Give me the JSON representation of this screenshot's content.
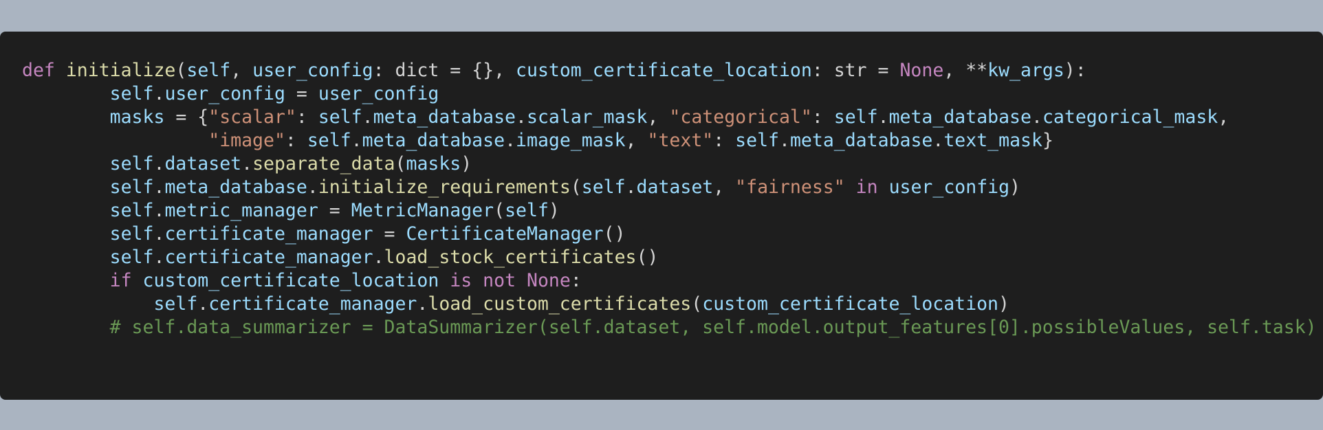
{
  "code": {
    "lines": [
      [
        {
          "t": "def",
          "c": "kw"
        },
        {
          "t": " ",
          "c": "plain"
        },
        {
          "t": "initialize",
          "c": "fn"
        },
        {
          "t": "(",
          "c": "plain"
        },
        {
          "t": "self",
          "c": "var"
        },
        {
          "t": ", ",
          "c": "plain"
        },
        {
          "t": "user_config",
          "c": "var"
        },
        {
          "t": ": dict = {}, ",
          "c": "plain"
        },
        {
          "t": "custom_certificate_location",
          "c": "var"
        },
        {
          "t": ": str = ",
          "c": "plain"
        },
        {
          "t": "None",
          "c": "kw"
        },
        {
          "t": ", **",
          "c": "plain"
        },
        {
          "t": "kw_args",
          "c": "var"
        },
        {
          "t": "):",
          "c": "plain"
        }
      ],
      [
        {
          "t": "        ",
          "c": "plain"
        },
        {
          "t": "self",
          "c": "var"
        },
        {
          "t": ".",
          "c": "plain"
        },
        {
          "t": "user_config",
          "c": "var"
        },
        {
          "t": " = ",
          "c": "plain"
        },
        {
          "t": "user_config",
          "c": "var"
        }
      ],
      [
        {
          "t": "        ",
          "c": "plain"
        },
        {
          "t": "masks",
          "c": "var"
        },
        {
          "t": " = {",
          "c": "plain"
        },
        {
          "t": "\"scalar\"",
          "c": "str"
        },
        {
          "t": ": ",
          "c": "plain"
        },
        {
          "t": "self",
          "c": "var"
        },
        {
          "t": ".",
          "c": "plain"
        },
        {
          "t": "meta_database",
          "c": "var"
        },
        {
          "t": ".",
          "c": "plain"
        },
        {
          "t": "scalar_mask",
          "c": "var"
        },
        {
          "t": ", ",
          "c": "plain"
        },
        {
          "t": "\"categorical\"",
          "c": "str"
        },
        {
          "t": ": ",
          "c": "plain"
        },
        {
          "t": "self",
          "c": "var"
        },
        {
          "t": ".",
          "c": "plain"
        },
        {
          "t": "meta_database",
          "c": "var"
        },
        {
          "t": ".",
          "c": "plain"
        },
        {
          "t": "categorical_mask",
          "c": "var"
        },
        {
          "t": ",",
          "c": "plain"
        }
      ],
      [
        {
          "t": "                 ",
          "c": "plain"
        },
        {
          "t": "\"image\"",
          "c": "str"
        },
        {
          "t": ": ",
          "c": "plain"
        },
        {
          "t": "self",
          "c": "var"
        },
        {
          "t": ".",
          "c": "plain"
        },
        {
          "t": "meta_database",
          "c": "var"
        },
        {
          "t": ".",
          "c": "plain"
        },
        {
          "t": "image_mask",
          "c": "var"
        },
        {
          "t": ", ",
          "c": "plain"
        },
        {
          "t": "\"text\"",
          "c": "str"
        },
        {
          "t": ": ",
          "c": "plain"
        },
        {
          "t": "self",
          "c": "var"
        },
        {
          "t": ".",
          "c": "plain"
        },
        {
          "t": "meta_database",
          "c": "var"
        },
        {
          "t": ".",
          "c": "plain"
        },
        {
          "t": "text_mask",
          "c": "var"
        },
        {
          "t": "}",
          "c": "plain"
        }
      ],
      [
        {
          "t": "        ",
          "c": "plain"
        },
        {
          "t": "self",
          "c": "var"
        },
        {
          "t": ".",
          "c": "plain"
        },
        {
          "t": "dataset",
          "c": "var"
        },
        {
          "t": ".",
          "c": "plain"
        },
        {
          "t": "separate_data",
          "c": "fn"
        },
        {
          "t": "(",
          "c": "plain"
        },
        {
          "t": "masks",
          "c": "var"
        },
        {
          "t": ")",
          "c": "plain"
        }
      ],
      [
        {
          "t": "        ",
          "c": "plain"
        },
        {
          "t": "self",
          "c": "var"
        },
        {
          "t": ".",
          "c": "plain"
        },
        {
          "t": "meta_database",
          "c": "var"
        },
        {
          "t": ".",
          "c": "plain"
        },
        {
          "t": "initialize_requirements",
          "c": "fn"
        },
        {
          "t": "(",
          "c": "plain"
        },
        {
          "t": "self",
          "c": "var"
        },
        {
          "t": ".",
          "c": "plain"
        },
        {
          "t": "dataset",
          "c": "var"
        },
        {
          "t": ", ",
          "c": "plain"
        },
        {
          "t": "\"fairness\"",
          "c": "str"
        },
        {
          "t": " ",
          "c": "plain"
        },
        {
          "t": "in",
          "c": "kw"
        },
        {
          "t": " ",
          "c": "plain"
        },
        {
          "t": "user_config",
          "c": "var"
        },
        {
          "t": ")",
          "c": "plain"
        }
      ],
      [
        {
          "t": "        ",
          "c": "plain"
        },
        {
          "t": "self",
          "c": "var"
        },
        {
          "t": ".",
          "c": "plain"
        },
        {
          "t": "metric_manager",
          "c": "var"
        },
        {
          "t": " = ",
          "c": "plain"
        },
        {
          "t": "MetricManager",
          "c": "cls2"
        },
        {
          "t": "(",
          "c": "plain"
        },
        {
          "t": "self",
          "c": "var"
        },
        {
          "t": ")",
          "c": "plain"
        }
      ],
      [
        {
          "t": "        ",
          "c": "plain"
        },
        {
          "t": "self",
          "c": "var"
        },
        {
          "t": ".",
          "c": "plain"
        },
        {
          "t": "certificate_manager",
          "c": "var"
        },
        {
          "t": " = ",
          "c": "plain"
        },
        {
          "t": "CertificateManager",
          "c": "cls2"
        },
        {
          "t": "()",
          "c": "plain"
        }
      ],
      [
        {
          "t": "        ",
          "c": "plain"
        },
        {
          "t": "self",
          "c": "var"
        },
        {
          "t": ".",
          "c": "plain"
        },
        {
          "t": "certificate_manager",
          "c": "var"
        },
        {
          "t": ".",
          "c": "plain"
        },
        {
          "t": "load_stock_certificates",
          "c": "fn"
        },
        {
          "t": "()",
          "c": "plain"
        }
      ],
      [
        {
          "t": "        ",
          "c": "plain"
        },
        {
          "t": "if",
          "c": "kw"
        },
        {
          "t": " ",
          "c": "plain"
        },
        {
          "t": "custom_certificate_location",
          "c": "var"
        },
        {
          "t": " ",
          "c": "plain"
        },
        {
          "t": "is",
          "c": "kw"
        },
        {
          "t": " ",
          "c": "plain"
        },
        {
          "t": "not",
          "c": "kw"
        },
        {
          "t": " ",
          "c": "plain"
        },
        {
          "t": "None",
          "c": "kw"
        },
        {
          "t": ":",
          "c": "plain"
        }
      ],
      [
        {
          "t": "            ",
          "c": "plain"
        },
        {
          "t": "self",
          "c": "var"
        },
        {
          "t": ".",
          "c": "plain"
        },
        {
          "t": "certificate_manager",
          "c": "var"
        },
        {
          "t": ".",
          "c": "plain"
        },
        {
          "t": "load_custom_certificates",
          "c": "fn"
        },
        {
          "t": "(",
          "c": "plain"
        },
        {
          "t": "custom_certificate_location",
          "c": "var"
        },
        {
          "t": ")",
          "c": "plain"
        }
      ],
      [
        {
          "t": "        ",
          "c": "plain"
        },
        {
          "t": "# self.data_summarizer = DataSummarizer(self.dataset, self.model.output_features[0].possibleValues, self.task)",
          "c": "com"
        }
      ]
    ]
  },
  "colors": {
    "background": "#aab4c1",
    "panel": "#1e1e1e",
    "keyword": "#c586c0",
    "function": "#dcdcaa",
    "variable": "#9cdcfe",
    "string": "#ce9178",
    "comment": "#6a9955",
    "plain": "#d4d4d4"
  }
}
